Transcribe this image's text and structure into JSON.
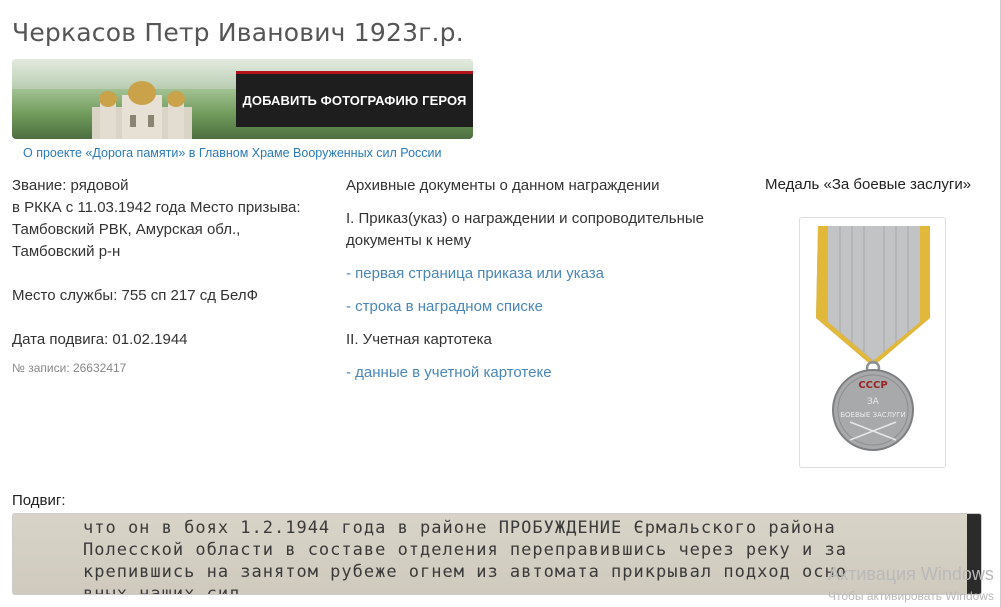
{
  "hero": {
    "title": "Черкасов Петр Иванович 1923г.р.",
    "add_photo_label": "ДОБАВИТЬ ФОТОГРАФИЮ ГЕРОЯ",
    "project_link": "О проекте «Дорога памяти» в Главном Храме Вооруженных сил России"
  },
  "info": {
    "rank_line": "Звание: рядовой",
    "conscription": "в РККА с 11.03.1942 года Место призыва: Тамбовский РВК, Амурская обл., Тамбовский р-н",
    "service": "Место службы: 755 сп 217 сд БелФ",
    "feat_date": "Дата подвига: 01.02.1944",
    "record_no": "№ записи: 26632417"
  },
  "archive": {
    "heading": "Архивные документы о данном награждении",
    "section1": "I. Приказ(указ) о награждении и сопроводительные документы к нему",
    "link_first_page": "- первая страница приказа или указа",
    "link_award_list": "- строка в наградном списке",
    "section2": "II. Учетная картотека",
    "link_card": "- данные в учетной картотеке"
  },
  "medal": {
    "title": "Медаль «За боевые заслуги»",
    "ribbon_color": "#b8b9bb",
    "ribbon_stripe_color": "#e2b83a",
    "inscription_top": "СССР",
    "inscription_mid": "ЗА",
    "inscription_bottom": "БОЕВЫЕ ЗАСЛУГИ"
  },
  "feat": {
    "label": "Подвиг:",
    "scan_lines": [
      "что он в боях 1.2.1944 года в районе ПРОБУЖДЕНИЕ Єрмальского района",
      "Полесской области в составе отделения переправившись через реку и за",
      "крепившись на занятом рубеже огнем из автомата прикрывал подход осно",
      "вных наших сил"
    ]
  },
  "watermark": {
    "line1": "Активация Windows",
    "line2": "Чтобы активировать Windows"
  }
}
